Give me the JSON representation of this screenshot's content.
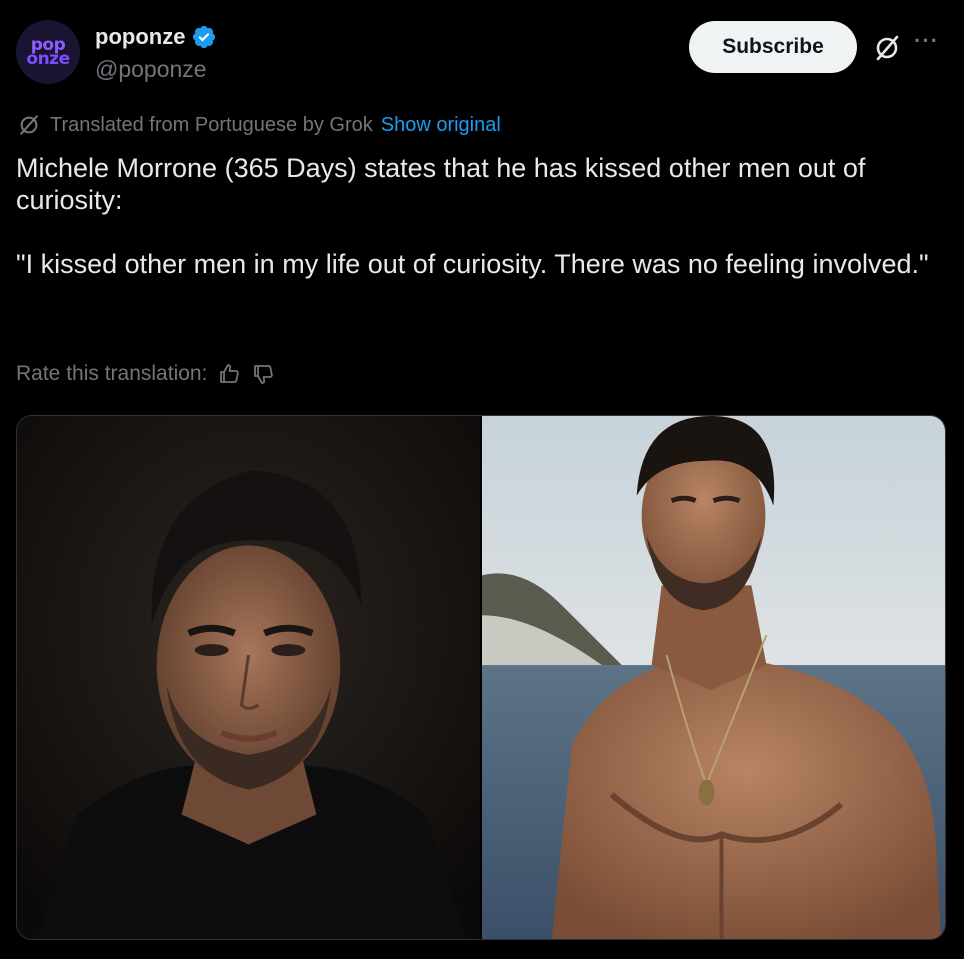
{
  "author": {
    "avatar_line1": "pop",
    "avatar_line2": "onze",
    "name": "poponze",
    "handle": "@poponze",
    "verified": true
  },
  "header": {
    "subscribe_label": "Subscribe",
    "more_label": "···"
  },
  "translation": {
    "notice": "Translated from Portuguese by Grok",
    "show_original": "Show original",
    "rate_label": "Rate this translation:"
  },
  "tweet": {
    "text": "Michele Morrone (365 Days) states that he has kissed other men out of curiosity:\n\n\"I kissed other men in my life out of curiosity. There was no feeling involved.\""
  },
  "media": {
    "photo_count": 2
  },
  "colors": {
    "background": "#000000",
    "accent": "#1d9bf0",
    "muted": "#71767b",
    "avatar_purple": "#8f5cff"
  },
  "icons": [
    "verified-badge-icon",
    "grok-icon",
    "more-icon",
    "translate-icon",
    "thumbs-up-icon",
    "thumbs-down-icon"
  ]
}
